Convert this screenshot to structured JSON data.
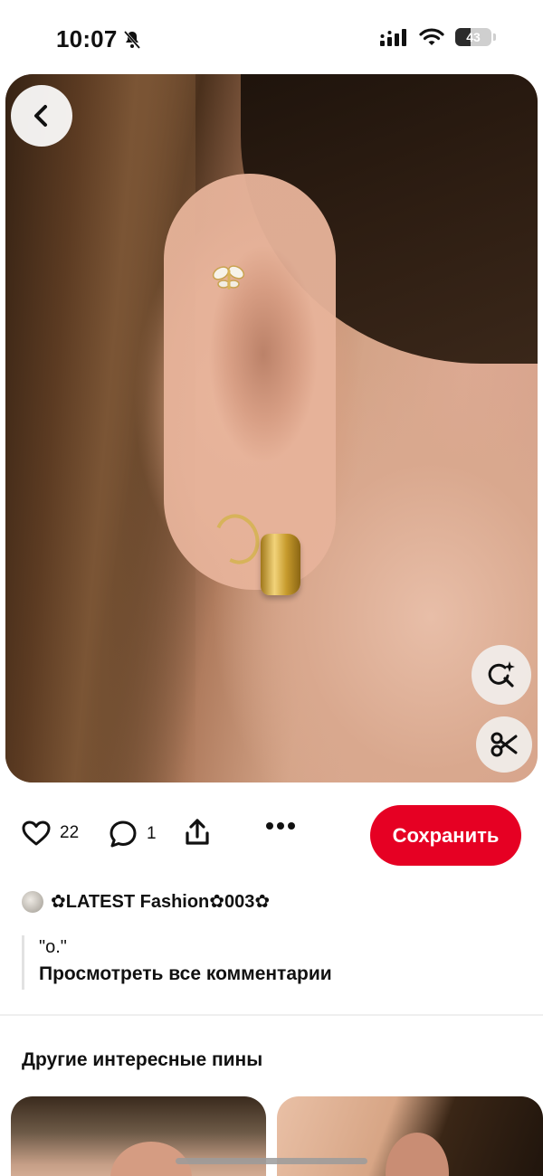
{
  "status_bar": {
    "time": "10:07",
    "battery": "43",
    "battery_level": 0.43
  },
  "pin": {
    "likes": "22",
    "comments": "1",
    "save_label": "Сохранить"
  },
  "author": {
    "name": "✿LATEST Fashion✿003✿"
  },
  "comments_section": {
    "first_comment": "\"o.\"",
    "view_all": "Просмотреть все комментарии"
  },
  "more_pins": {
    "title": "Другие интересные пины"
  },
  "colors": {
    "save_button": "#e60023"
  }
}
